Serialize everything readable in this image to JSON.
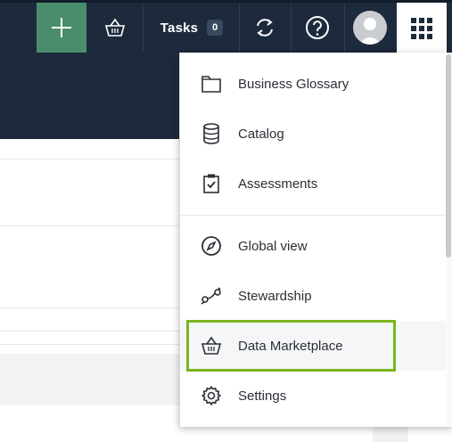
{
  "topbar": {
    "tasks_label": "Tasks",
    "tasks_count": "0"
  },
  "menu": {
    "items": [
      {
        "label": "Business Glossary",
        "icon": "folder-icon"
      },
      {
        "label": "Catalog",
        "icon": "database-icon"
      },
      {
        "label": "Assessments",
        "icon": "clipboard-check-icon"
      },
      {
        "label": "Global view",
        "icon": "compass-icon"
      },
      {
        "label": "Stewardship",
        "icon": "stewardship-arrows-icon"
      },
      {
        "label": "Data Marketplace",
        "icon": "basket-icon"
      },
      {
        "label": "Settings",
        "icon": "gear-icon"
      }
    ],
    "highlighted": "Data Marketplace"
  },
  "colors": {
    "topbar_bg": "#1d2a3c",
    "add_button_bg": "#4a8d6c",
    "highlight_border": "#7ab51d"
  }
}
